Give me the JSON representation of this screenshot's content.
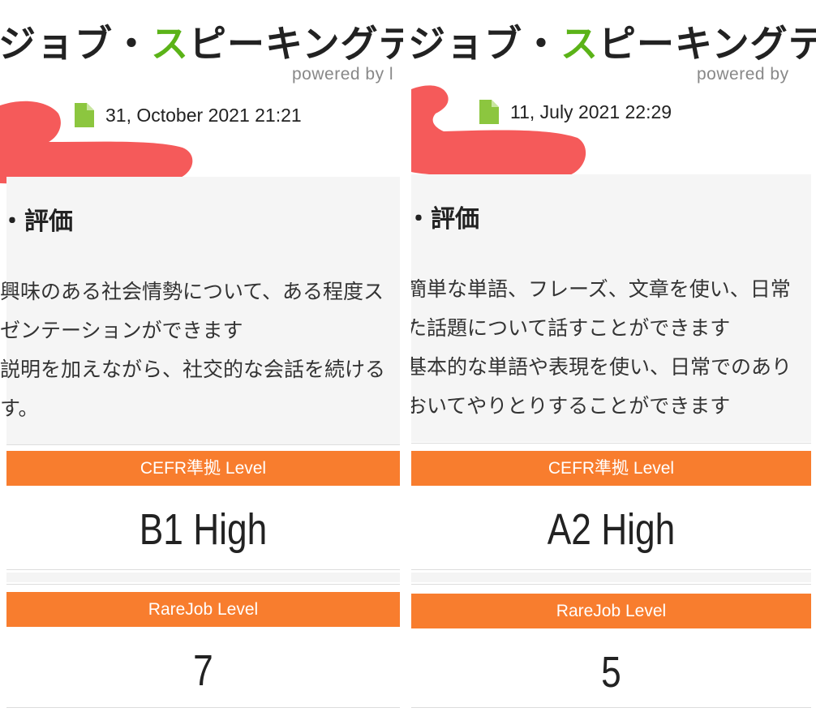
{
  "header": {
    "title_prefix": "ジョブ・",
    "title_accent": "ス",
    "title_suffix": "ピーキングテ",
    "powered_left": "powered by l",
    "powered_right": "powered by",
    "accent_color": "#5bb318"
  },
  "icons": {
    "document": "document-icon",
    "document_color": "#8cc63f"
  },
  "level_bar_color": "#f87d2e",
  "results": [
    {
      "date": "31, October 2021 21:21",
      "eval_title": "評価",
      "eval_lines": [
        "興味のある社会情勢について、ある程度ス",
        "ゼンテーションができます",
        "説明を加えながら、社交的な会話を続ける",
        "す。"
      ],
      "cefr_label": "CEFR準拠 Level",
      "cefr_value": "B1 High",
      "rarejob_label": "RareJob Level",
      "rarejob_value": "7"
    },
    {
      "date": "11, July 2021 22:29",
      "eval_title": "評価",
      "eval_lines": [
        "簡単な単語、フレーズ、文章を使い、日常",
        "た話題について話すことができます",
        "基本的な単語や表現を使い、日常でのあり",
        "おいてやりとりすることができます"
      ],
      "cefr_label": "CEFR準拠 Level",
      "cefr_value": "A2 High",
      "rarejob_label": "RareJob Level",
      "rarejob_value": "5"
    }
  ]
}
